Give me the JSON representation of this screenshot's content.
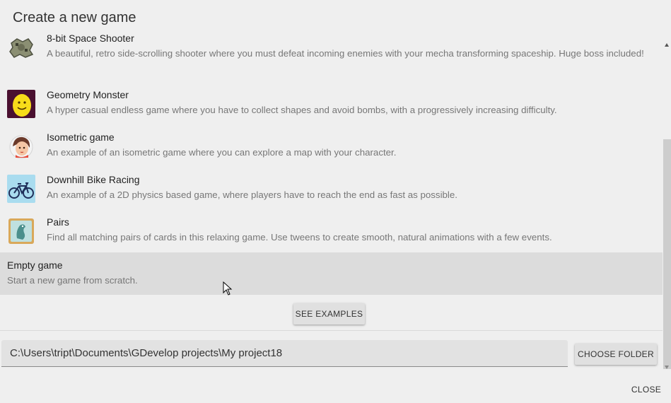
{
  "dialog": {
    "title": "Create a new game"
  },
  "games": [
    {
      "title": "8-bit Space Shooter",
      "description": "A beautiful, retro side-scrolling shooter where you must defeat incoming enemies with your mecha transforming spaceship. Huge boss included!",
      "icon": "spaceship-thumbnail"
    },
    {
      "title": "Geometry Monster",
      "description": "A hyper casual endless game where you have to collect shapes and avoid bombs, with a progressively increasing difficulty.",
      "icon": "monster-thumbnail"
    },
    {
      "title": "Isometric game",
      "description": "An example of an isometric game where you can explore a map with your character.",
      "icon": "character-thumbnail"
    },
    {
      "title": "Downhill Bike Racing",
      "description": "An example of a 2D physics based game, where players have to reach the end as fast as possible.",
      "icon": "bike-thumbnail"
    },
    {
      "title": "Pairs",
      "description": "Find all matching pairs of cards in this relaxing game. Use tweens to create smooth, natural animations with a few events.",
      "icon": "cards-thumbnail"
    },
    {
      "title": "Empty game",
      "description": "Start a new game from scratch.",
      "selected": true
    }
  ],
  "buttons": {
    "see_examples": "See examples",
    "choose_folder": "Choose folder",
    "close": "Close"
  },
  "project_path": {
    "value": "C:\\Users\\tript\\Documents\\GDevelop projects\\My project18"
  },
  "colors": {
    "background": "#efefef",
    "selected_row": "#dcdcdc",
    "button": "#e0e0e0"
  }
}
